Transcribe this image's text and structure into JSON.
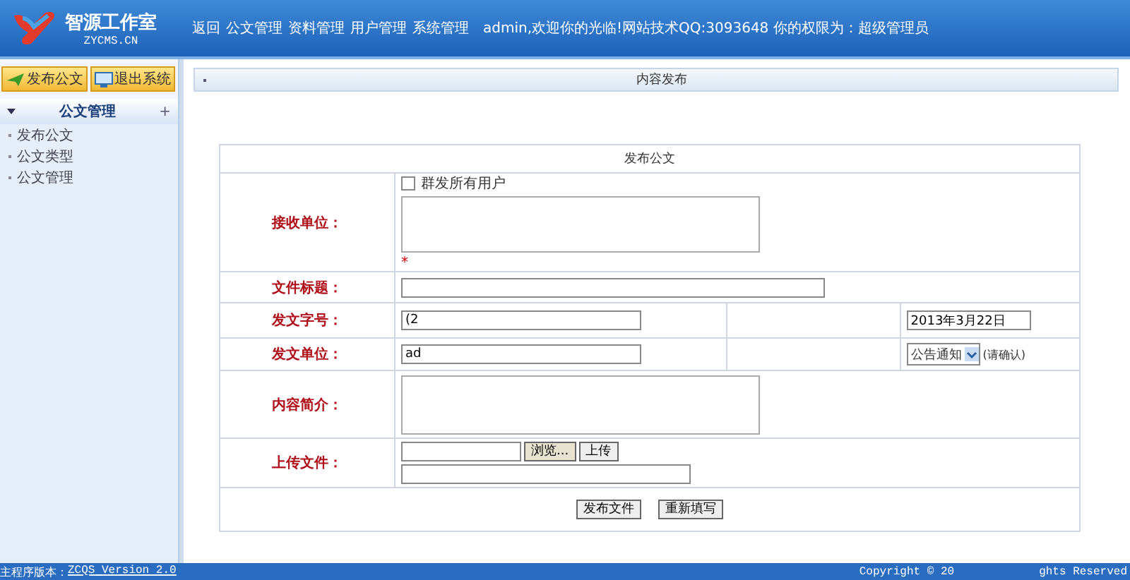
{
  "logo": {
    "title": "智源工作室",
    "subtitle": "ZYCMS.CN"
  },
  "nav": [
    {
      "label": "返回"
    },
    {
      "label": "公文管理"
    },
    {
      "label": "资料管理"
    },
    {
      "label": "用户管理"
    },
    {
      "label": "系统管理"
    }
  ],
  "welcome": "admin,欢迎你的光临!网站技术QQ:3093648 你的权限为：超级管理员",
  "toolbar": [
    {
      "label": "发布公文",
      "kind": "publish"
    },
    {
      "label": "退出系统",
      "kind": "logout"
    }
  ],
  "sidebar": {
    "title": "公文管理",
    "expand": "+",
    "expanded": true,
    "items": [
      {
        "label": "发布公文"
      },
      {
        "label": "公文类型"
      },
      {
        "label": "公文管理"
      }
    ]
  },
  "panel": {
    "title": "内容发布"
  },
  "form": {
    "title": "发布公文",
    "rows": [
      {
        "kind": "recipients",
        "label": "接收单位：",
        "checkbox": {
          "label": "群发所有用户",
          "checked": false
        },
        "hint": "*"
      },
      {
        "kind": "text",
        "label": "文件标题："
      },
      {
        "kind": "pair",
        "label": "发文字号：",
        "value": "(2",
        "value2": "2013年3月22日"
      },
      {
        "kind": "select",
        "label": "发文单位：",
        "value": "ad",
        "select": "公告通知",
        "note": "(请确认)"
      },
      {
        "kind": "textarea",
        "label": "内容简介："
      },
      {
        "kind": "upload",
        "label": "上传文件：",
        "browse": "浏览...",
        "upload": "上传"
      }
    ],
    "buttons": [
      {
        "label": "发布文件"
      },
      {
        "label": "重新填写"
      }
    ]
  },
  "footer": {
    "version_label": "主程序版本：",
    "version": "ZCQS Version 2.0",
    "copyright": "Copyright © 20",
    "rights": "ghts Reserved"
  }
}
